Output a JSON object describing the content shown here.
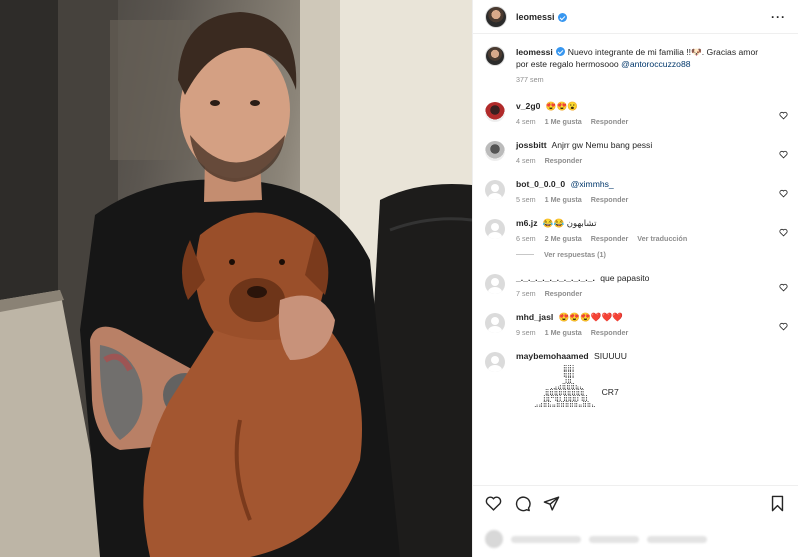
{
  "post": {
    "username": "leomessi",
    "caption": "Nuevo integrante de mi familia !!🐶. Gracias amor por este regalo hermosooo",
    "caption_mention": "@antoroccuzzo88",
    "caption_time": "377 sem"
  },
  "comments": [
    {
      "username": "v_2g0",
      "text": "😍😍😮",
      "time": "4 sem",
      "likes": "1 Me gusta",
      "reply": "Responder",
      "avatar": "photo-red"
    },
    {
      "username": "jossbitt",
      "text": "Anjrr gw Nemu bang pessi",
      "time": "4 sem",
      "likes": "",
      "reply": "Responder",
      "avatar": "photo-gray"
    },
    {
      "username": "bot_0_0.0_0",
      "text": "@ximmhs_",
      "time": "5 sem",
      "likes": "1 Me gusta",
      "reply": "Responder",
      "avatar": "default"
    },
    {
      "username": "m6.jz",
      "text": "😂😂 تشابهون",
      "time": "6 sem",
      "likes": "2 Me gusta",
      "reply": "Responder",
      "translate": "Ver traducción",
      "replies": "Ver respuestas (1)",
      "avatar": "default"
    },
    {
      "username": "_._._._._._._._._._._.",
      "text": "que papasito",
      "time": "7 sem",
      "likes": "",
      "reply": "Responder",
      "avatar": "default"
    },
    {
      "username": "mhd_jasl",
      "text": "😍😍😍❤️❤️❤️",
      "time": "9 sem",
      "likes": "1 Me gusta",
      "reply": "Responder",
      "avatar": "default"
    },
    {
      "username": "maybemohaamed",
      "text": "SIUUUU",
      "time": "",
      "likes": "",
      "reply": "",
      "avatar": "default",
      "ascii_label": "CR7"
    }
  ],
  "colors": {
    "verified": "#3897f0",
    "link": "#00376b",
    "muted": "#8e8e8e"
  },
  "icons": [
    "more-icon",
    "heart-icon",
    "comment-icon",
    "share-icon",
    "bookmark-icon"
  ]
}
